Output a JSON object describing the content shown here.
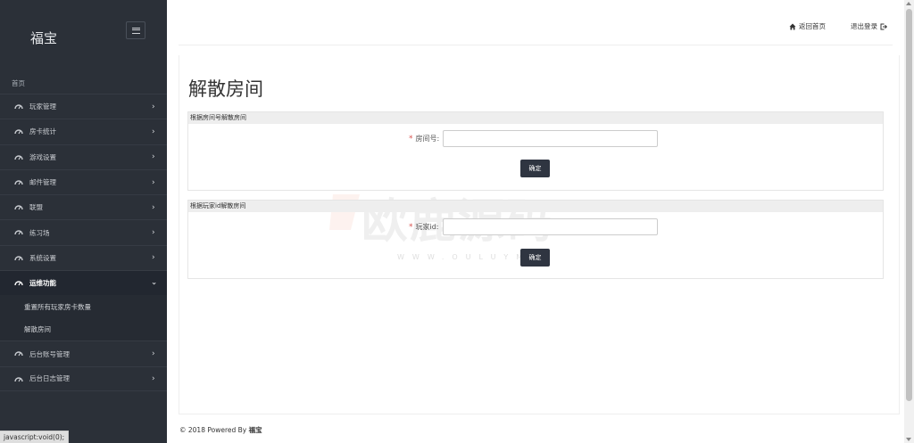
{
  "sidebar": {
    "brand": "福宝",
    "home": "首页",
    "items": [
      {
        "label": "玩家管理"
      },
      {
        "label": "房卡统计"
      },
      {
        "label": "游戏设置"
      },
      {
        "label": "邮件管理"
      },
      {
        "label": "联盟"
      },
      {
        "label": "练习场"
      },
      {
        "label": "系统设置"
      },
      {
        "label": "运维功能"
      },
      {
        "label": "后台账号管理"
      },
      {
        "label": "后台日志管理"
      }
    ],
    "subitems": [
      {
        "label": "重置所有玩家房卡数量"
      },
      {
        "label": "解散房间"
      }
    ]
  },
  "topbar": {
    "home_link": "返回首页",
    "logout_link": "退出登录"
  },
  "main": {
    "title": "解散房间",
    "section1": {
      "heading": "根据房间号解散房间",
      "field_label": "房间号:",
      "button": "确定"
    },
    "section2": {
      "heading": "根据玩家id解散房间",
      "field_label": "玩家id:",
      "button": "确定"
    }
  },
  "footer": {
    "prefix": "© 2018 Powered By",
    "brand": "福宝"
  },
  "status_bar": "javascript:void(0);",
  "watermark": {
    "text": "欧鹿源码",
    "sub": "WWW.OULUYM"
  }
}
